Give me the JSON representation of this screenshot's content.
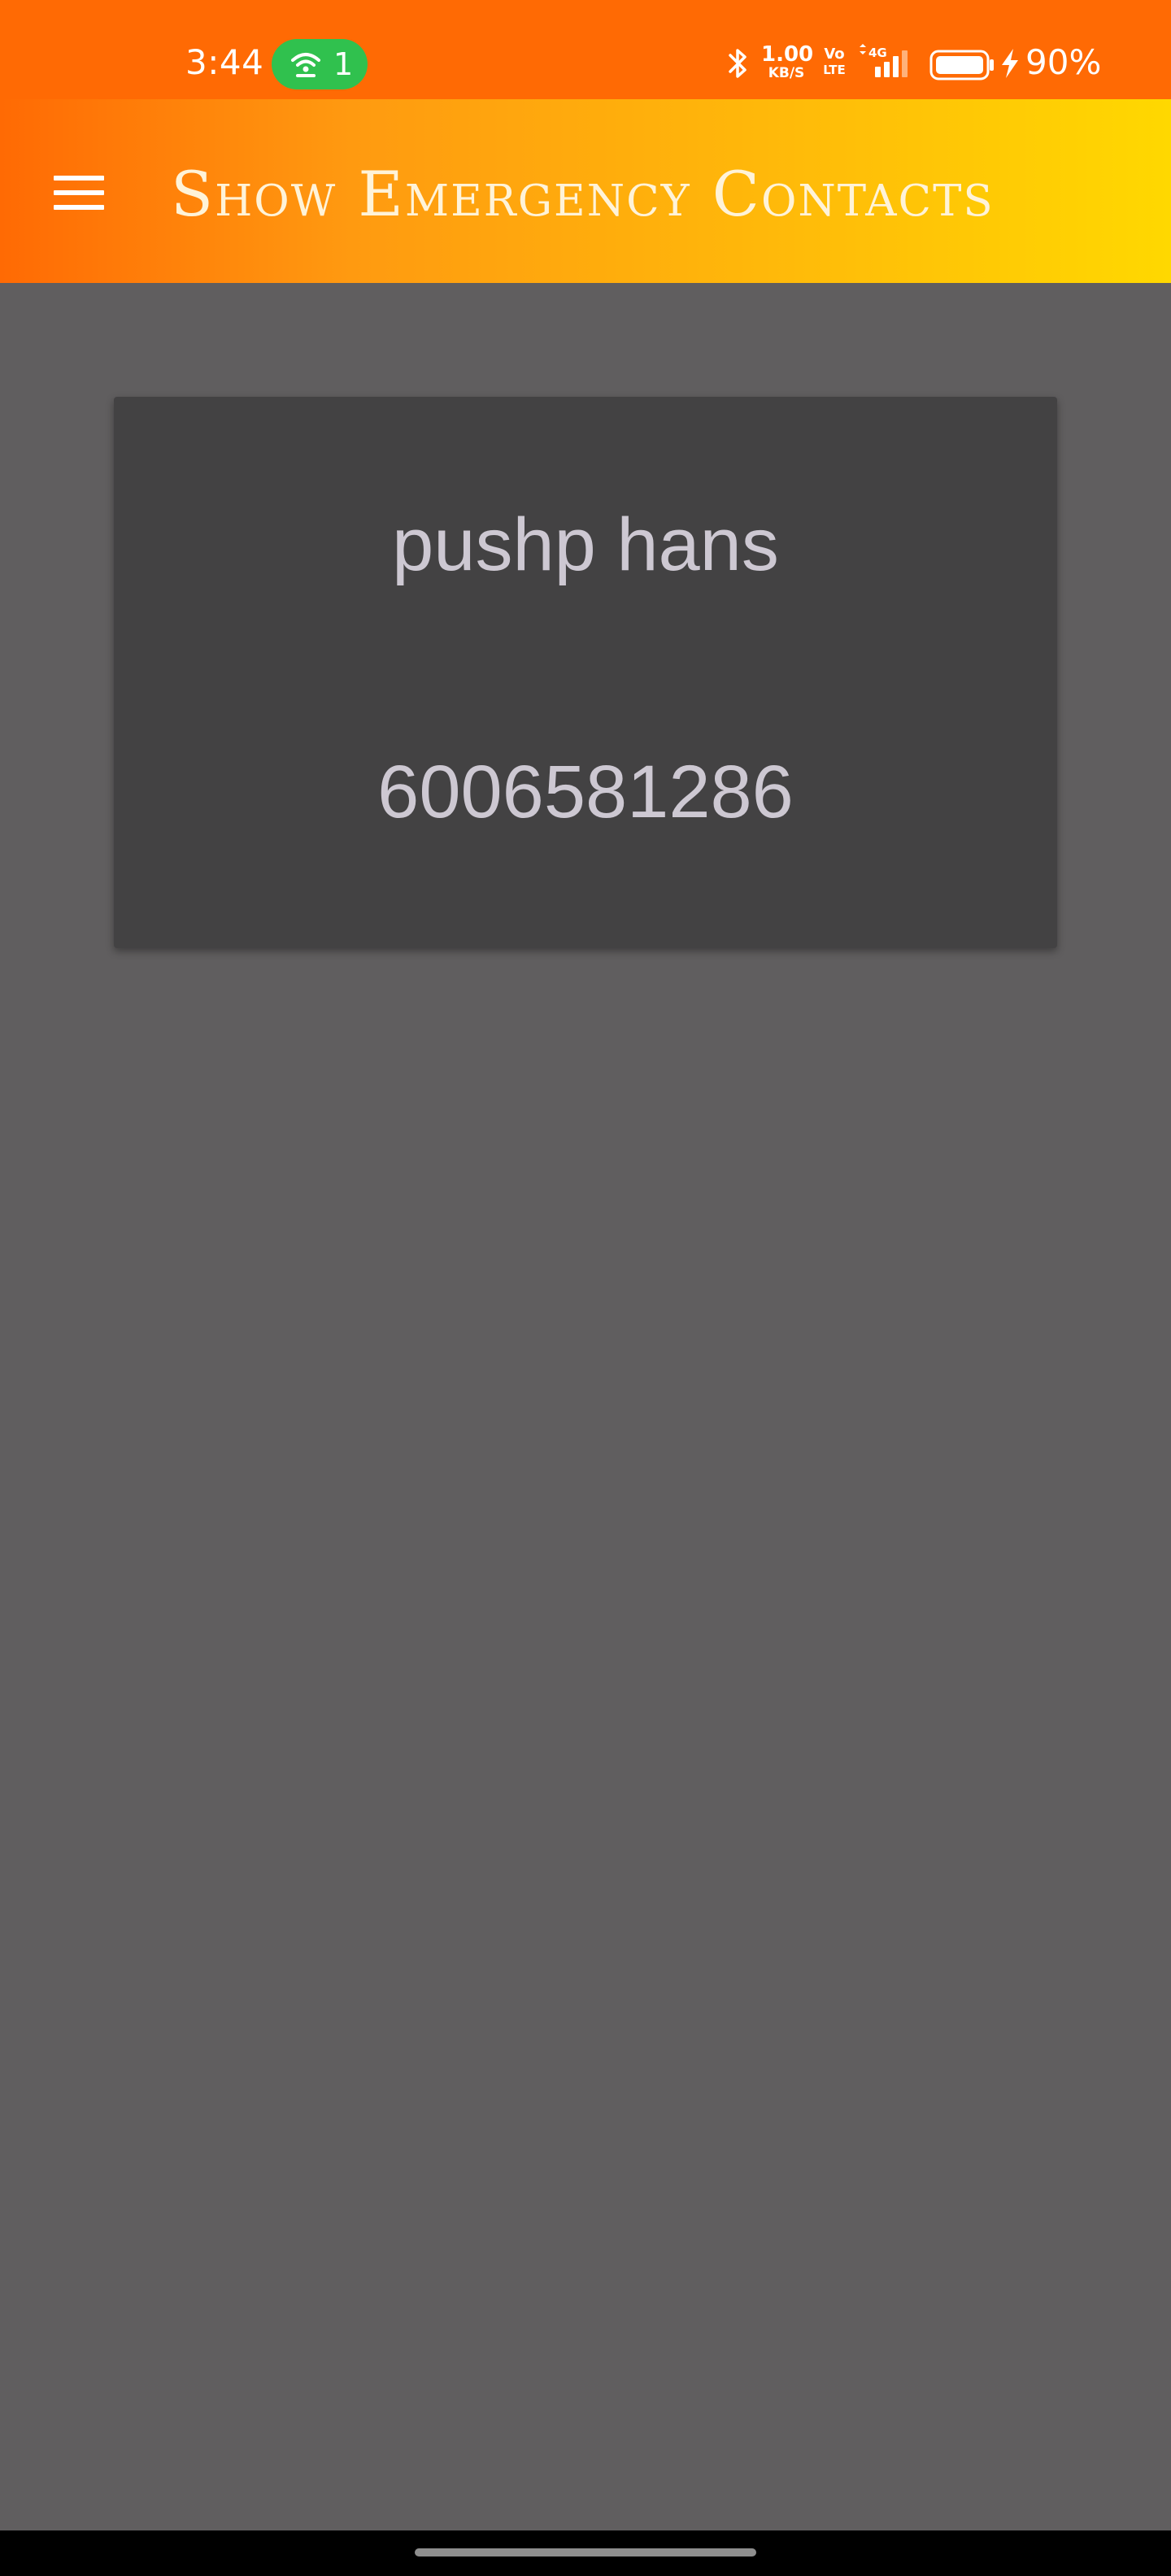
{
  "status_bar": {
    "time": "3:44",
    "hotspot_icon": "hotspot-icon",
    "hotspot_count": "1",
    "bluetooth_icon": "bluetooth-icon",
    "net_speed_value": "1.00",
    "net_speed_unit": "KB/S",
    "volte_top": "Vo",
    "volte_bottom": "LTE",
    "signal_label": "4G",
    "battery_percent": "90%",
    "hotspot_color": "#30c14e",
    "background_color": "#ff6a04"
  },
  "app_bar": {
    "menu_icon": "hamburger-menu-icon",
    "title": "Show Emergency Contacts",
    "gradient_start": "#ff6a04",
    "gradient_end": "#ffd800"
  },
  "contacts": [
    {
      "name": "pushp hans",
      "phone": "6006581286"
    }
  ],
  "theme": {
    "page_background": "#605e5f",
    "card_background": "#434243",
    "card_text": "#cdc8d2"
  }
}
